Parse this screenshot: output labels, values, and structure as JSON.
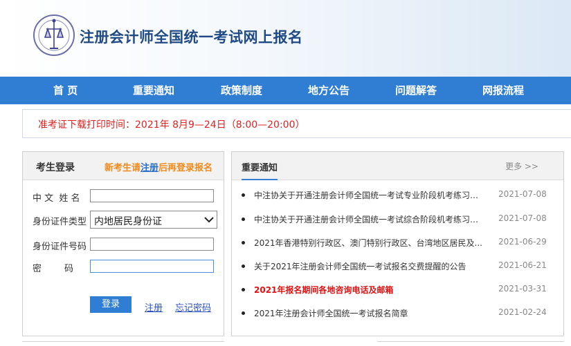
{
  "header": {
    "site_title": "注册会计师全国统一考试网上报名"
  },
  "nav": {
    "items": [
      "首 页",
      "重要通知",
      "政策制度",
      "地方公告",
      "问题解答",
      "网报流程"
    ]
  },
  "notice": {
    "text": "准考证下载打印时间：2021年 8月9—24日（8:00—20:00）"
  },
  "login": {
    "title": "考生登录",
    "hint_prefix": "新考生请",
    "hint_link": "注册",
    "hint_suffix": "后再登录报名",
    "fields": {
      "name_label": "中 文  姓 名",
      "id_type_label": "身份证件类型",
      "id_type_value": "内地居民身份证",
      "id_number_label": "身份证件号码",
      "password_label": "密        码"
    },
    "login_button": "登录",
    "register_link": "注册",
    "forgot_link": "忘记密码"
  },
  "news": {
    "title": "重要通知",
    "more": "更多 >>",
    "items": [
      {
        "title": "中注协关于开通注册会计师全国统一考试专业阶段机考练习网站...",
        "date": "2021-07-08",
        "highlight": false
      },
      {
        "title": "中注协关于开通注册会计师全国统一考试综合阶段机考练习网站...",
        "date": "2021-07-08",
        "highlight": false
      },
      {
        "title": "2021年香港特别行政区、澳门特别行政区、台湾地区居民及...",
        "date": "2021-06-29",
        "highlight": false
      },
      {
        "title": "关于2021年注册会计师全国统一考试报名交费提醒的公告",
        "date": "2021-06-21",
        "highlight": false
      },
      {
        "title": "2021年报名期间各地咨询电话及邮箱",
        "date": "2021-03-31",
        "highlight": true
      },
      {
        "title": "2021年注册会计师全国统一考试报名简章",
        "date": "2021-02-24",
        "highlight": false
      }
    ]
  },
  "colors": {
    "nav_bg": "#2f7ed3",
    "title": "#1f4a86",
    "notice": "#e02020",
    "hint": "#f08a1b",
    "highlight": "#e01010"
  }
}
